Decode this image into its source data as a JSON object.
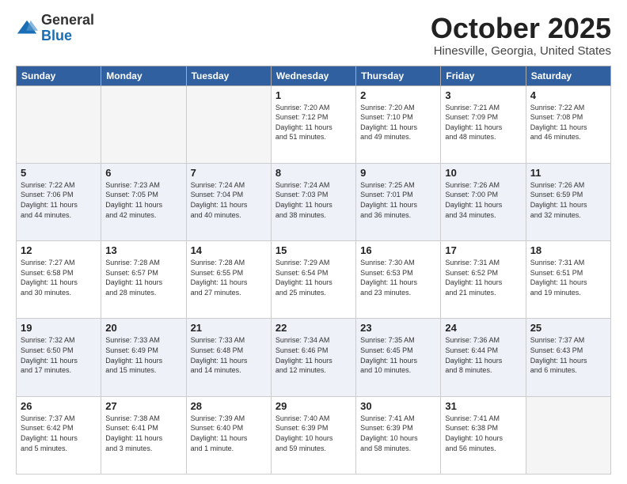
{
  "header": {
    "logo_general": "General",
    "logo_blue": "Blue",
    "month": "October 2025",
    "location": "Hinesville, Georgia, United States"
  },
  "weekdays": [
    "Sunday",
    "Monday",
    "Tuesday",
    "Wednesday",
    "Thursday",
    "Friday",
    "Saturday"
  ],
  "weeks": [
    [
      {
        "day": "",
        "info": ""
      },
      {
        "day": "",
        "info": ""
      },
      {
        "day": "",
        "info": ""
      },
      {
        "day": "1",
        "info": "Sunrise: 7:20 AM\nSunset: 7:12 PM\nDaylight: 11 hours\nand 51 minutes."
      },
      {
        "day": "2",
        "info": "Sunrise: 7:20 AM\nSunset: 7:10 PM\nDaylight: 11 hours\nand 49 minutes."
      },
      {
        "day": "3",
        "info": "Sunrise: 7:21 AM\nSunset: 7:09 PM\nDaylight: 11 hours\nand 48 minutes."
      },
      {
        "day": "4",
        "info": "Sunrise: 7:22 AM\nSunset: 7:08 PM\nDaylight: 11 hours\nand 46 minutes."
      }
    ],
    [
      {
        "day": "5",
        "info": "Sunrise: 7:22 AM\nSunset: 7:06 PM\nDaylight: 11 hours\nand 44 minutes."
      },
      {
        "day": "6",
        "info": "Sunrise: 7:23 AM\nSunset: 7:05 PM\nDaylight: 11 hours\nand 42 minutes."
      },
      {
        "day": "7",
        "info": "Sunrise: 7:24 AM\nSunset: 7:04 PM\nDaylight: 11 hours\nand 40 minutes."
      },
      {
        "day": "8",
        "info": "Sunrise: 7:24 AM\nSunset: 7:03 PM\nDaylight: 11 hours\nand 38 minutes."
      },
      {
        "day": "9",
        "info": "Sunrise: 7:25 AM\nSunset: 7:01 PM\nDaylight: 11 hours\nand 36 minutes."
      },
      {
        "day": "10",
        "info": "Sunrise: 7:26 AM\nSunset: 7:00 PM\nDaylight: 11 hours\nand 34 minutes."
      },
      {
        "day": "11",
        "info": "Sunrise: 7:26 AM\nSunset: 6:59 PM\nDaylight: 11 hours\nand 32 minutes."
      }
    ],
    [
      {
        "day": "12",
        "info": "Sunrise: 7:27 AM\nSunset: 6:58 PM\nDaylight: 11 hours\nand 30 minutes."
      },
      {
        "day": "13",
        "info": "Sunrise: 7:28 AM\nSunset: 6:57 PM\nDaylight: 11 hours\nand 28 minutes."
      },
      {
        "day": "14",
        "info": "Sunrise: 7:28 AM\nSunset: 6:55 PM\nDaylight: 11 hours\nand 27 minutes."
      },
      {
        "day": "15",
        "info": "Sunrise: 7:29 AM\nSunset: 6:54 PM\nDaylight: 11 hours\nand 25 minutes."
      },
      {
        "day": "16",
        "info": "Sunrise: 7:30 AM\nSunset: 6:53 PM\nDaylight: 11 hours\nand 23 minutes."
      },
      {
        "day": "17",
        "info": "Sunrise: 7:31 AM\nSunset: 6:52 PM\nDaylight: 11 hours\nand 21 minutes."
      },
      {
        "day": "18",
        "info": "Sunrise: 7:31 AM\nSunset: 6:51 PM\nDaylight: 11 hours\nand 19 minutes."
      }
    ],
    [
      {
        "day": "19",
        "info": "Sunrise: 7:32 AM\nSunset: 6:50 PM\nDaylight: 11 hours\nand 17 minutes."
      },
      {
        "day": "20",
        "info": "Sunrise: 7:33 AM\nSunset: 6:49 PM\nDaylight: 11 hours\nand 15 minutes."
      },
      {
        "day": "21",
        "info": "Sunrise: 7:33 AM\nSunset: 6:48 PM\nDaylight: 11 hours\nand 14 minutes."
      },
      {
        "day": "22",
        "info": "Sunrise: 7:34 AM\nSunset: 6:46 PM\nDaylight: 11 hours\nand 12 minutes."
      },
      {
        "day": "23",
        "info": "Sunrise: 7:35 AM\nSunset: 6:45 PM\nDaylight: 11 hours\nand 10 minutes."
      },
      {
        "day": "24",
        "info": "Sunrise: 7:36 AM\nSunset: 6:44 PM\nDaylight: 11 hours\nand 8 minutes."
      },
      {
        "day": "25",
        "info": "Sunrise: 7:37 AM\nSunset: 6:43 PM\nDaylight: 11 hours\nand 6 minutes."
      }
    ],
    [
      {
        "day": "26",
        "info": "Sunrise: 7:37 AM\nSunset: 6:42 PM\nDaylight: 11 hours\nand 5 minutes."
      },
      {
        "day": "27",
        "info": "Sunrise: 7:38 AM\nSunset: 6:41 PM\nDaylight: 11 hours\nand 3 minutes."
      },
      {
        "day": "28",
        "info": "Sunrise: 7:39 AM\nSunset: 6:40 PM\nDaylight: 11 hours\nand 1 minute."
      },
      {
        "day": "29",
        "info": "Sunrise: 7:40 AM\nSunset: 6:39 PM\nDaylight: 10 hours\nand 59 minutes."
      },
      {
        "day": "30",
        "info": "Sunrise: 7:41 AM\nSunset: 6:39 PM\nDaylight: 10 hours\nand 58 minutes."
      },
      {
        "day": "31",
        "info": "Sunrise: 7:41 AM\nSunset: 6:38 PM\nDaylight: 10 hours\nand 56 minutes."
      },
      {
        "day": "",
        "info": ""
      }
    ]
  ]
}
